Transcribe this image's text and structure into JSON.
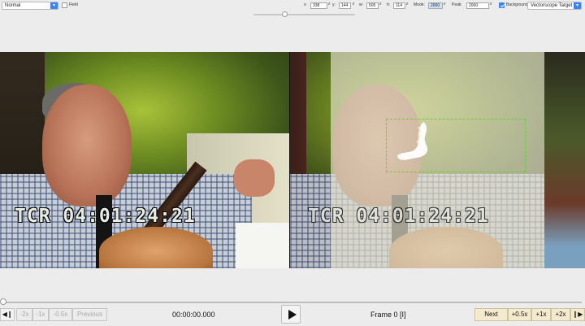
{
  "toolbar": {
    "mode_select": "Normal",
    "field_label": "Field",
    "x_label": "x:",
    "x_value": "338",
    "y_label": "y:",
    "y_value": "144",
    "w_label": "w:",
    "w_value": "505",
    "h_label": "h:",
    "h_value": "114",
    "mode_label": "Mode:",
    "mode_value": "2000",
    "peak_label": "Peak:",
    "peak_value": "2000",
    "background_label": "Background",
    "background_checked": true,
    "scope_select": "Vectorscope Target"
  },
  "video": {
    "left_timecode": "TCR 04:01:24:21",
    "right_timecode": "TCR 04:01:24:21"
  },
  "transport": {
    "step_back_icon": "step-back-icon",
    "speed_minus_2x": "-2x",
    "speed_minus_1x": "-1x",
    "speed_minus_05x": "-0.5x",
    "previous": "Previous",
    "timecode": "00:00:00.000",
    "play_icon": "play-icon",
    "frame": "Frame 0 [I]",
    "next": "Next",
    "speed_plus_05x": "+0.5x",
    "speed_plus_1x": "+1x",
    "speed_plus_2x": "+2x",
    "step_forward_icon": "step-forward-icon"
  },
  "playback_position": 0,
  "colors": {
    "accent": "#3d82f2",
    "target_box": "#6cc940",
    "scope_trace": "#ffffff"
  }
}
